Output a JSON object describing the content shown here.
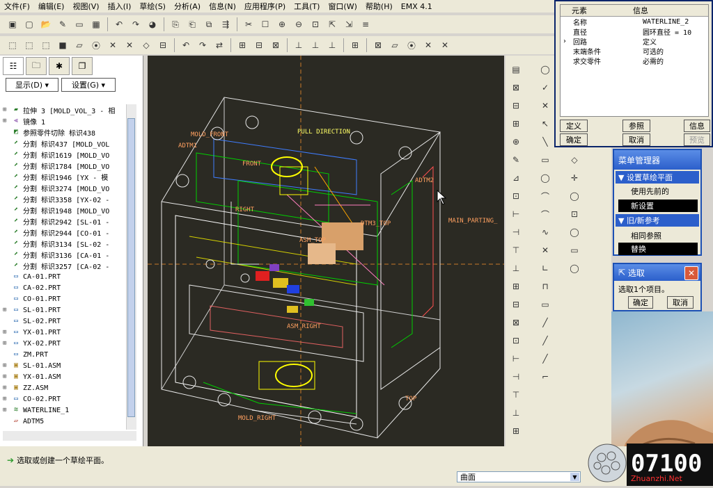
{
  "menubar": [
    "文件(F)",
    "编辑(E)",
    "视图(V)",
    "插入(I)",
    "草绘(S)",
    "分析(A)",
    "信息(N)",
    "应用程序(P)",
    "工具(T)",
    "窗口(W)",
    "帮助(H)",
    "EMX 4.1"
  ],
  "panel_tabs": [
    "model-tree-icon",
    "folder-icon",
    "star-icon",
    "layers-icon"
  ],
  "display_label": "显示(D) ▾",
  "settings_label": "设置(G) ▾",
  "tree": [
    {
      "exp": "⊞",
      "icon": "extrude-icon",
      "label": "拉伸 3 [MOLD_VOL_3 - 相"
    },
    {
      "exp": "⊞",
      "icon": "mirror-icon",
      "label": "镜像 1"
    },
    {
      "exp": "",
      "icon": "cut-icon",
      "label": "参照零件切除 标识438"
    },
    {
      "exp": "",
      "icon": "split-icon",
      "label": "分割 标识437 [MOLD_VOL"
    },
    {
      "exp": "",
      "icon": "split-icon",
      "label": "分割 标识1619 [MOLD_VO"
    },
    {
      "exp": "",
      "icon": "split-icon",
      "label": "分割 标识1784 [MOLD_VO"
    },
    {
      "exp": "",
      "icon": "split-icon",
      "label": "分割 标识1946 [YX - 模"
    },
    {
      "exp": "",
      "icon": "split-icon",
      "label": "分割 标识3274 [MOLD_VO"
    },
    {
      "exp": "",
      "icon": "split-icon",
      "label": "分割 标识3358 [YX-02 -"
    },
    {
      "exp": "",
      "icon": "split-icon",
      "label": "分割 标识1948 [MOLD_VO"
    },
    {
      "exp": "",
      "icon": "split-icon",
      "label": "分割 标识2942 [SL-01 -"
    },
    {
      "exp": "",
      "icon": "split-icon",
      "label": "分割 标识2944 [CO-01 -"
    },
    {
      "exp": "",
      "icon": "split-icon",
      "label": "分割 标识3134 [SL-02 -"
    },
    {
      "exp": "",
      "icon": "split-icon",
      "label": "分割 标识3136 [CA-01 -"
    },
    {
      "exp": "",
      "icon": "split-icon",
      "label": "分割 标识3257 [CA-02 -"
    },
    {
      "exp": "",
      "icon": "part-icon",
      "label": "CA-01.PRT"
    },
    {
      "exp": "",
      "icon": "part-icon",
      "label": "CA-02.PRT"
    },
    {
      "exp": "",
      "icon": "part-icon",
      "label": "CO-01.PRT"
    },
    {
      "exp": "⊞",
      "icon": "part-icon",
      "label": "SL-01.PRT"
    },
    {
      "exp": "",
      "icon": "part-icon",
      "label": "SL-02.PRT"
    },
    {
      "exp": "⊞",
      "icon": "part-icon",
      "label": "YX-01.PRT"
    },
    {
      "exp": "⊞",
      "icon": "part-icon",
      "label": "YX-02.PRT"
    },
    {
      "exp": "",
      "icon": "part-icon",
      "label": "ZM.PRT"
    },
    {
      "exp": "⊞",
      "icon": "assembly-icon",
      "label": "SL-01.ASM"
    },
    {
      "exp": "⊞",
      "icon": "assembly-icon",
      "label": "YX-01.ASM"
    },
    {
      "exp": "⊞",
      "icon": "assembly-icon",
      "label": "ZZ.ASM"
    },
    {
      "exp": "⊞",
      "icon": "part-icon",
      "label": "CO-02.PRT"
    },
    {
      "exp": "⊞",
      "icon": "waterline-icon",
      "label": "WATERLINE_1"
    },
    {
      "exp": "",
      "icon": "datum-plane-icon",
      "label": "ADTM5"
    }
  ],
  "gfx_labels": {
    "pull_direction": "PULL DIRECTION",
    "mold_front": "MOLD_FRONT",
    "adtm1": "ADTM1",
    "front": "FRONT",
    "right": "RIGHT",
    "dtm_top": "DTM3_TOP",
    "main_parting": "MAIN_PARTING_",
    "adtm2": "ADTM2",
    "asm_top": "ASM_TOP",
    "asm_right": "ASM_RIGHT",
    "mold_right": "MOLD_RIGHT",
    "top": "TOP"
  },
  "info": {
    "col_element": "元素",
    "col_info": "信息",
    "rows": [
      {
        "k": "名称",
        "v": "WATERLINE_2",
        "mark": ""
      },
      {
        "k": "直径",
        "v": "圆环直径 = 10",
        "mark": ""
      },
      {
        "k": "回路",
        "v": "定义",
        "mark": "›"
      },
      {
        "k": "末端条件",
        "v": "可选的",
        "mark": ""
      },
      {
        "k": "求交零件",
        "v": "必需的",
        "mark": ""
      }
    ],
    "define": "定义",
    "reference": "参照",
    "information": "信息",
    "ok": "确定",
    "cancel": "取消",
    "preview": "预览"
  },
  "menumgr": {
    "title": "菜单管理器",
    "sec1": "设置草绘平面",
    "use_prev": "使用先前的",
    "new_setting": "新设置",
    "sec2": "旧/新参考",
    "same_ref": "相同参照",
    "replace": "替换"
  },
  "select": {
    "title": "选取",
    "msg": "选取1个项目。",
    "ok": "确定",
    "cancel": "取消"
  },
  "status_msg": "选取或创建一个草绘平面。",
  "filter_value": "曲面",
  "logo_text": "07100",
  "logo_sub": "Zhuanzhi.Net"
}
